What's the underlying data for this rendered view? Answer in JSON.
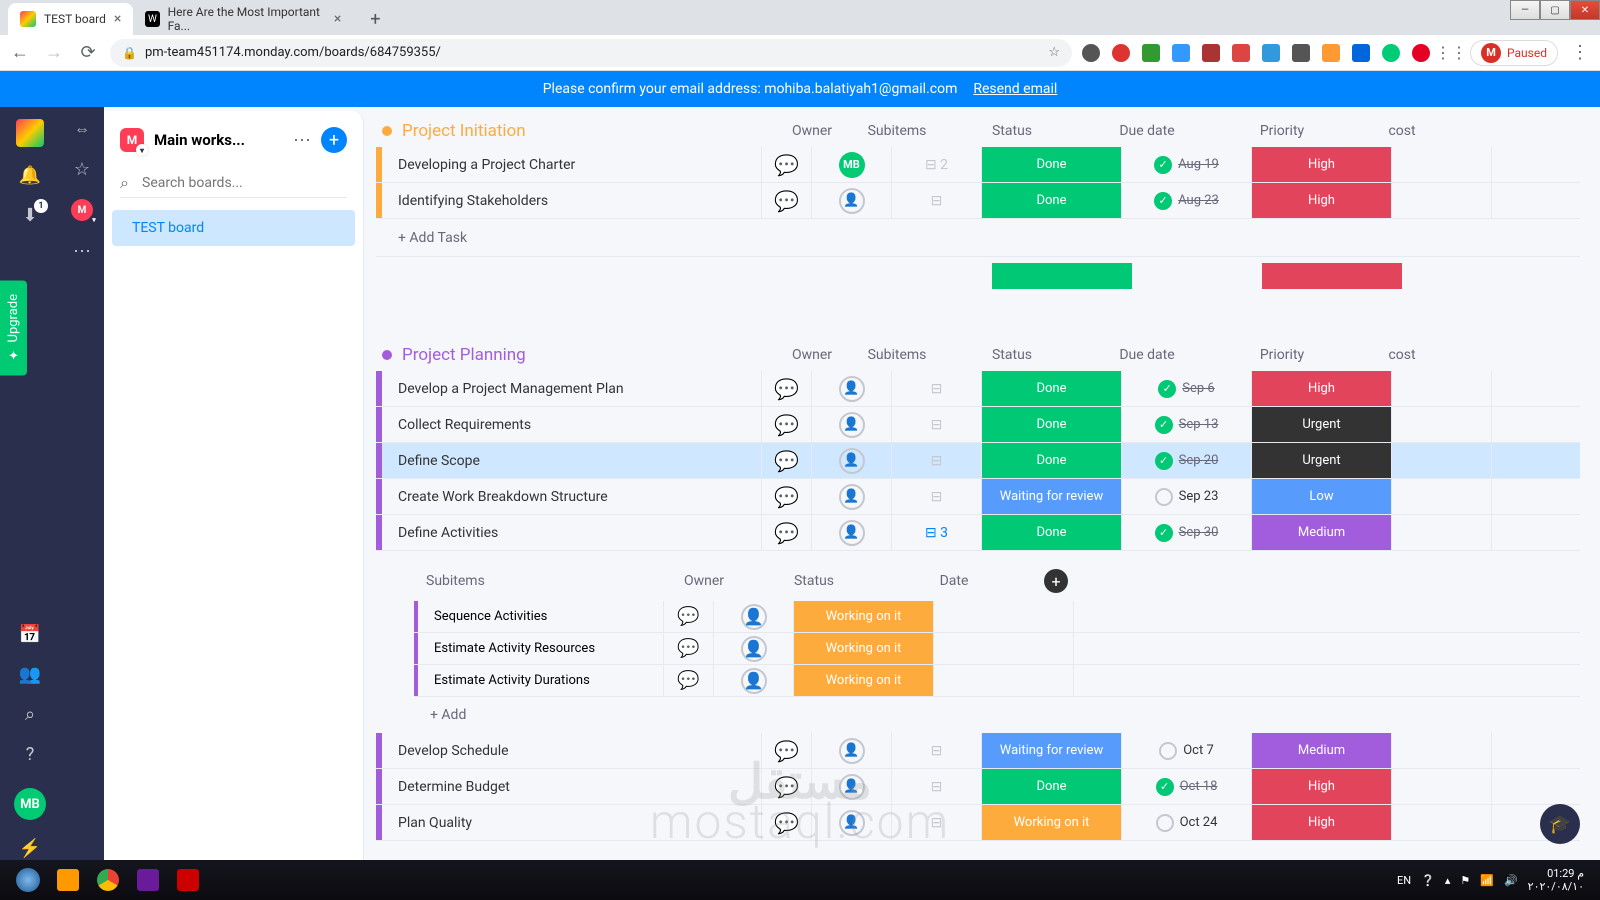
{
  "window": {
    "min": "—",
    "max": "▢",
    "close": "✕"
  },
  "browser": {
    "tabs": [
      {
        "title": "TEST board",
        "active": true
      },
      {
        "title": "Here Are the Most Important Fa...",
        "active": false
      }
    ],
    "url": "pm-team451174.monday.com/boards/684759355/",
    "profile_label": "Paused",
    "profile_initial": "M"
  },
  "banner": {
    "text": "Please confirm your email address: mohiba.balatiyah1@gmail.com",
    "action": "Resend email"
  },
  "sidebar": {
    "workspace": "Main works...",
    "search_placeholder": "Search boards...",
    "board": "TEST board"
  },
  "rail": {
    "download_badge": "1",
    "avatar": "MB"
  },
  "upgrade": "Upgrade",
  "columns": {
    "owner": "Owner",
    "subitems": "Subitems",
    "status": "Status",
    "due": "Due date",
    "priority": "Priority",
    "cost": "cost"
  },
  "groups": [
    {
      "title": "Project Initiation",
      "color": "#fdab3d",
      "tasks": [
        {
          "name": "Developing a Project Charter",
          "owner": "MB",
          "sub": "2",
          "status": "Done",
          "status_class": "st-done",
          "due": "Aug 19",
          "struck": true,
          "checked": true,
          "priority": "High",
          "pr_class": "pr-high"
        },
        {
          "name": "Identifying Stakeholders",
          "owner": "",
          "sub": "",
          "status": "Done",
          "status_class": "st-done",
          "due": "Aug 23",
          "struck": true,
          "checked": true,
          "priority": "High",
          "pr_class": "pr-high"
        }
      ],
      "add_label": "+ Add Task"
    },
    {
      "title": "Project Planning",
      "color": "#a25ddc",
      "tasks": [
        {
          "name": "Develop a Project Management Plan",
          "owner": "",
          "sub": "",
          "status": "Done",
          "status_class": "st-done",
          "due": "Sep 6",
          "struck": true,
          "checked": true,
          "priority": "High",
          "pr_class": "pr-high"
        },
        {
          "name": "Collect Requirements",
          "owner": "",
          "sub": "",
          "status": "Done",
          "status_class": "st-done",
          "due": "Sep 13",
          "struck": true,
          "checked": true,
          "priority": "Urgent",
          "pr_class": "pr-urgent"
        },
        {
          "name": "Define Scope",
          "owner": "",
          "sub": "",
          "status": "Done",
          "status_class": "st-done",
          "due": "Sep 20",
          "struck": true,
          "checked": true,
          "priority": "Urgent",
          "pr_class": "pr-urgent",
          "highlight": true
        },
        {
          "name": "Create Work Breakdown Structure",
          "owner": "",
          "sub": "",
          "status": "Waiting for review",
          "status_class": "st-waiting",
          "due": "Sep 23",
          "struck": false,
          "checked": false,
          "priority": "Low",
          "pr_class": "pr-low"
        },
        {
          "name": "Define Activities",
          "owner": "",
          "sub": "3",
          "sub_active": true,
          "status": "Done",
          "status_class": "st-done",
          "due": "Sep 30",
          "struck": true,
          "checked": true,
          "priority": "Medium",
          "pr_class": "pr-medium"
        }
      ],
      "subitems": {
        "headers": {
          "name": "Subitems",
          "owner": "Owner",
          "status": "Status",
          "date": "Date"
        },
        "rows": [
          {
            "name": "Sequence Activities",
            "status": "Working on it",
            "status_class": "st-working"
          },
          {
            "name": "Estimate Activity Resources",
            "status": "Working on it",
            "status_class": "st-working"
          },
          {
            "name": "Estimate Activity Durations",
            "status": "Working on it",
            "status_class": "st-working"
          }
        ],
        "add": "+ Add"
      },
      "tasks_after": [
        {
          "name": "Develop Schedule",
          "owner": "",
          "sub": "",
          "status": "Waiting for review",
          "status_class": "st-waiting",
          "due": "Oct 7",
          "struck": false,
          "checked": false,
          "priority": "Medium",
          "pr_class": "pr-medium"
        },
        {
          "name": "Determine Budget",
          "owner": "",
          "sub": "",
          "status": "Done",
          "status_class": "st-done",
          "due": "Oct 18",
          "struck": true,
          "checked": true,
          "priority": "High",
          "pr_class": "pr-high"
        },
        {
          "name": "Plan Quality",
          "owner": "",
          "sub": "",
          "status": "Working on it",
          "status_class": "st-working",
          "due": "Oct 24",
          "struck": false,
          "checked": false,
          "priority": "High",
          "pr_class": "pr-high"
        }
      ]
    }
  ],
  "taskbar": {
    "lang": "EN",
    "time": "01:29 م",
    "date": "٢٠٢٠/٠٨/١٠"
  },
  "watermark": {
    "en": "mostaql.com",
    "ar": "مستقل"
  }
}
